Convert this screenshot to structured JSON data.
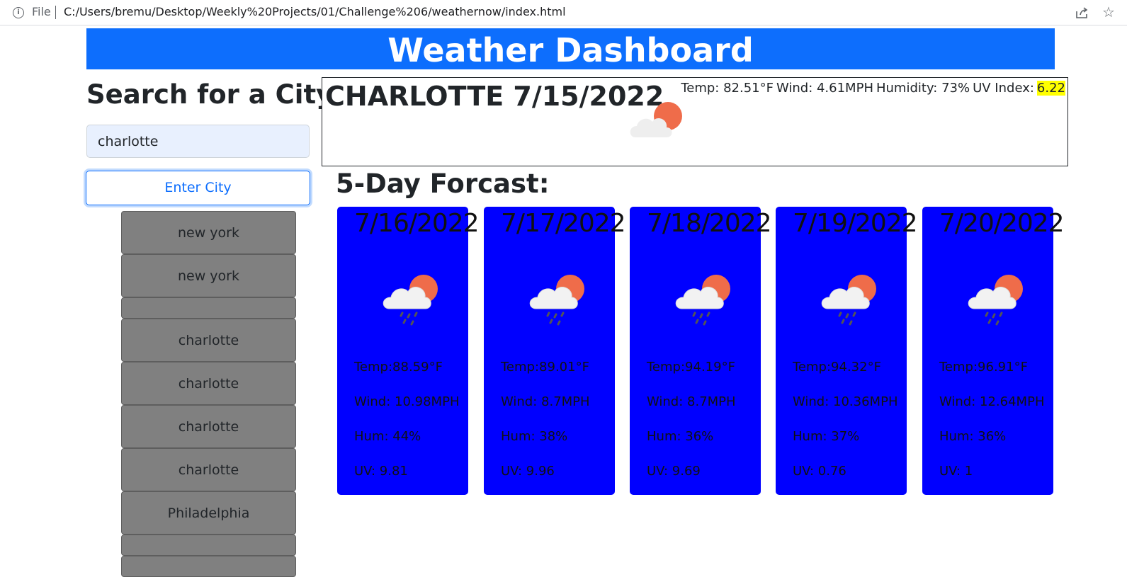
{
  "browser": {
    "file_label": "File",
    "url": "C:/Users/bremu/Desktop/Weekly%20Projects/01/Challenge%206/weathernow/index.html"
  },
  "header": {
    "title": "Weather Dashboard"
  },
  "search": {
    "heading": "Search for a City:",
    "input_value": "charlotte",
    "button_label": "Enter City"
  },
  "history": [
    "new york",
    "new york",
    "",
    "charlotte",
    "charlotte",
    "charlotte",
    "charlotte",
    "Philadelphia",
    "",
    ""
  ],
  "current": {
    "title": "CHARLOTTE 7/15/2022",
    "temp": "Temp: 82.51°F",
    "wind": "Wind: 4.61MPH",
    "humidity": "Humidity: 73%",
    "uv_label": "UV Index:",
    "uv_value": "6.22",
    "icon": "partly-cloudy-icon"
  },
  "forecast": {
    "heading": "5-Day Forcast:",
    "days": [
      {
        "date": "7/16/2022",
        "icon": "rain-sun-icon",
        "temp": "Temp:88.59°F",
        "wind": "Wind: 10.98MPH",
        "hum": "Hum: 44%",
        "uv": "UV: 9.81"
      },
      {
        "date": "7/17/2022",
        "icon": "rain-sun-icon",
        "temp": "Temp:89.01°F",
        "wind": "Wind: 8.7MPH",
        "hum": "Hum: 38%",
        "uv": "UV: 9.96"
      },
      {
        "date": "7/18/2022",
        "icon": "rain-sun-icon",
        "temp": "Temp:94.19°F",
        "wind": "Wind: 8.7MPH",
        "hum": "Hum: 36%",
        "uv": "UV: 9.69"
      },
      {
        "date": "7/19/2022",
        "icon": "rain-sun-icon",
        "temp": "Temp:94.32°F",
        "wind": "Wind: 10.36MPH",
        "hum": "Hum: 37%",
        "uv": "UV: 0.76"
      },
      {
        "date": "7/20/2022",
        "icon": "rain-sun-icon",
        "temp": "Temp:96.91°F",
        "wind": "Wind: 12.64MPH",
        "hum": "Hum: 36%",
        "uv": "UV: 1"
      }
    ]
  },
  "colors": {
    "banner": "#0d6efd",
    "forecast_card": "#0000ff",
    "history_button": "#808080",
    "uv_highlight": "#ffff00"
  }
}
